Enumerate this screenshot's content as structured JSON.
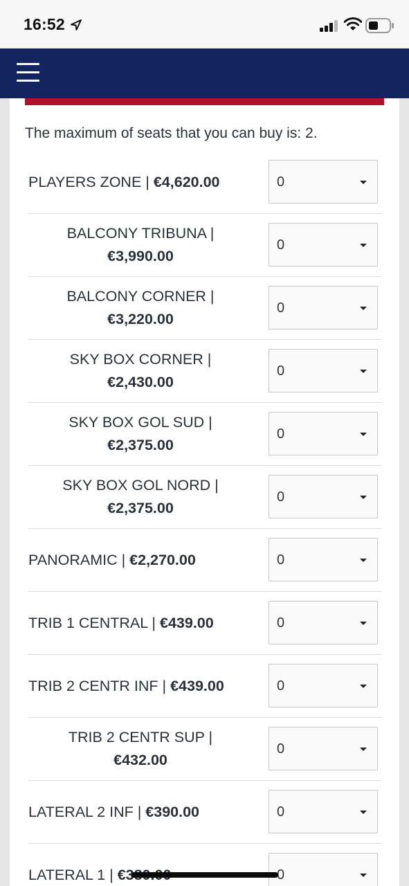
{
  "status_bar": {
    "time": "16:52"
  },
  "intro_text": "The maximum of seats that you can buy is: 2.",
  "select_default": "0",
  "seats": [
    {
      "name": "PLAYERS ZONE |",
      "price": "€4,620.00"
    },
    {
      "name": "BALCONY TRIBUNA |",
      "price": "€3,990.00"
    },
    {
      "name": "BALCONY CORNER |",
      "price": "€3,220.00"
    },
    {
      "name": "SKY BOX CORNER |",
      "price": "€2,430.00"
    },
    {
      "name": "SKY BOX GOL SUD |",
      "price": "€2,375.00"
    },
    {
      "name": "SKY BOX GOL NORD |",
      "price": "€2,375.00"
    },
    {
      "name": "PANORAMIC |",
      "price": "€2,270.00"
    },
    {
      "name": "TRIB 1 CENTRAL |",
      "price": "€439.00"
    },
    {
      "name": "TRIB 2 CENTR INF |",
      "price": "€439.00"
    },
    {
      "name": "TRIB 2 CENTR SUP |",
      "price": "€432.00"
    },
    {
      "name": "LATERAL 2 INF |",
      "price": "€390.00"
    },
    {
      "name": "LATERAL 1 |",
      "price": "€380.00"
    }
  ]
}
